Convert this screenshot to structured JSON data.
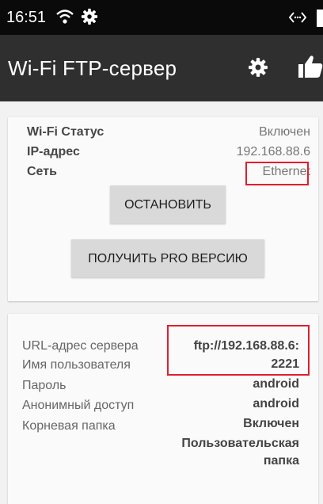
{
  "status_bar": {
    "time": "16:51",
    "icons": [
      "wifi-icon",
      "gear-icon",
      "nfc-icon",
      "battery-icon"
    ]
  },
  "app_bar": {
    "title": "Wi-Fi FTP-сервер",
    "icons": [
      "settings-gear-icon",
      "thumbs-up-icon"
    ]
  },
  "status_card": {
    "rows": [
      {
        "label": "Wi-Fi Статус",
        "value": "Включен"
      },
      {
        "label": "IP-адрес",
        "value": "192.168.88.6"
      },
      {
        "label": "Сеть",
        "value": "Ethernet"
      }
    ],
    "stop_button": "ОСТАНОВИТЬ",
    "pro_button": "ПОЛУЧИТЬ PRO ВЕРСИЮ"
  },
  "server_card": {
    "labels": [
      "URL-адрес сервера",
      "Имя пользователя",
      "Пароль",
      "Анонимный доступ",
      "Корневая папка"
    ],
    "url_line1": "ftp://192.168.88.6:",
    "url_line2": "2221",
    "username": "android",
    "password": "android",
    "anonymous": "Включен",
    "root_line1": "Пользовательская",
    "root_line2": "папка"
  },
  "colors": {
    "status_bar": "#0a0a0a",
    "app_bar": "#2f2f2f",
    "background": "#f2f2f2",
    "card": "#fafafa",
    "button": "#d9d9d9",
    "highlight": "#e01e2d"
  }
}
